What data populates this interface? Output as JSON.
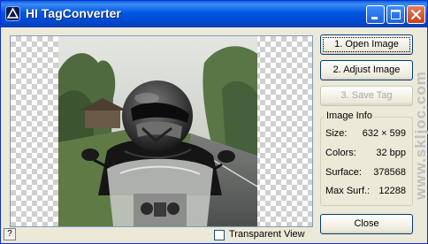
{
  "window": {
    "title": "HI TagConverter"
  },
  "buttons": {
    "open_image": "1.  Open Image",
    "adjust_image": "2.  Adjust Image",
    "save_tag": "3.  Save Tag",
    "close": "Close",
    "help": "?"
  },
  "image_info": {
    "title": "Image Info",
    "rows": [
      {
        "label": "Size:",
        "value": "632 × 599"
      },
      {
        "label": "Colors:",
        "value": "32 bpp"
      },
      {
        "label": "Surface:",
        "value": "378568"
      },
      {
        "label": "Max Surf.:",
        "value": "12288"
      }
    ]
  },
  "transparent_view": {
    "label": "Transparent View",
    "checked": false
  },
  "watermark": "www.skljoc.com",
  "colors": {
    "titlebar": "#0055e5",
    "window_bg": "#ece9d8",
    "close_button": "#c6441c"
  }
}
